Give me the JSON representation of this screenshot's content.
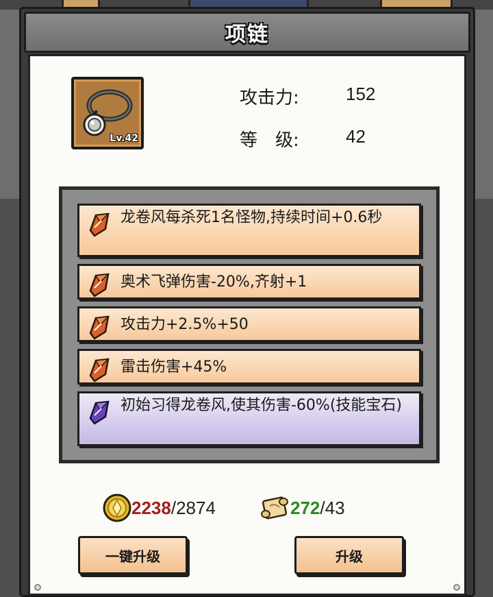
{
  "item": {
    "title": "项链",
    "level_badge": "Lv.42",
    "icon": "necklace-icon"
  },
  "stats": {
    "attack_label": "攻击力:",
    "attack_value": "152",
    "level_label": "等　级:",
    "level_value": "42"
  },
  "effects": [
    {
      "text": "龙卷风每杀死1名怪物,持续时间+0.6秒",
      "gem": "orange-gem-icon"
    },
    {
      "text": "奥术飞弹伤害-20%,齐射+1",
      "gem": "orange-gem-icon"
    },
    {
      "text": "攻击力+2.5%+50",
      "gem": "orange-gem-icon"
    },
    {
      "text": "雷击伤害+45%",
      "gem": "orange-gem-icon"
    },
    {
      "text": "初始习得龙卷风,使其伤害-60%(技能宝石)",
      "gem": "purple-gem-icon"
    }
  ],
  "costs": {
    "gold_current": "2238",
    "gold_required": "/2874",
    "scroll_current": "272",
    "scroll_required": "/43"
  },
  "buttons": {
    "one_click_upgrade": "一键升级",
    "upgrade": "升级"
  },
  "colors": {
    "effect_orange": "#f8c99b",
    "effect_purple": "#c5b8e6",
    "insufficient": "#a2201e",
    "sufficient": "#2a8a1f"
  }
}
